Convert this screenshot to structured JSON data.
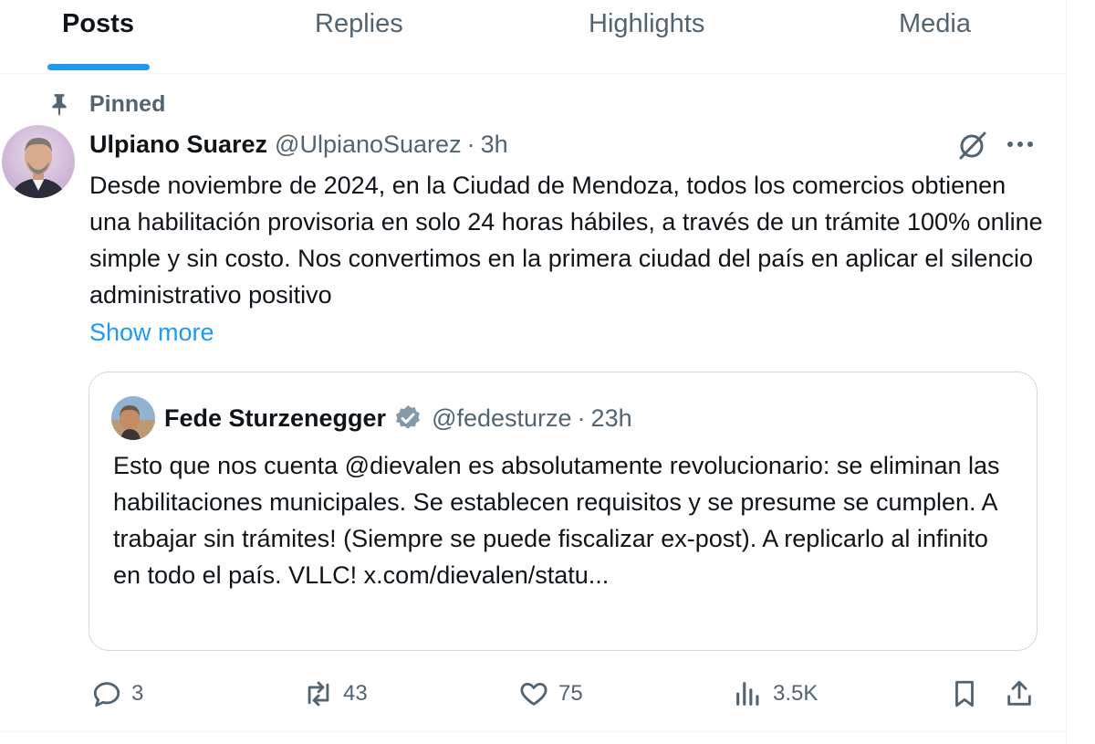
{
  "tabs": [
    {
      "label": "Posts",
      "active": true
    },
    {
      "label": "Replies",
      "active": false
    },
    {
      "label": "Highlights",
      "active": false
    },
    {
      "label": "Media",
      "active": false
    }
  ],
  "accent_color": "#1d9bf0",
  "post": {
    "pinned_label": "Pinned",
    "author_name": "Ulpiano Suarez",
    "author_handle": "@UlpianoSuarez",
    "separator": "·",
    "time": "3h",
    "text": "Desde noviembre de 2024, en la Ciudad de Mendoza, todos los comercios obtienen una habilitación provisoria en solo 24 horas hábiles, a través de un trámite 100% online simple y sin costo. Nos convertimos en la primera ciudad del país en aplicar el silencio administrativo positivo",
    "show_more": "Show more",
    "icons": {
      "pin": "pin-icon",
      "grok": "grok-icon",
      "more": "more-icon"
    }
  },
  "quote": {
    "author_name": "Fede Sturzenegger",
    "verified": true,
    "author_handle": "@fedesturze",
    "separator": "·",
    "time": "23h",
    "text": "Esto que nos cuenta @dievalen es absolutamente revolucionario: se eliminan las habilitaciones municipales. Se establecen requisitos y se presume se cumplen. A trabajar sin trámites! (Siempre se puede fiscalizar ex-post). A replicarlo al infinito en todo el país. VLLC! x.com/dievalen/statu..."
  },
  "actions": {
    "replies": "3",
    "reposts": "43",
    "likes": "75",
    "views": "3.5K",
    "icons": [
      "reply-icon",
      "repost-icon",
      "like-icon",
      "views-icon",
      "bookmark-icon",
      "share-icon"
    ]
  }
}
